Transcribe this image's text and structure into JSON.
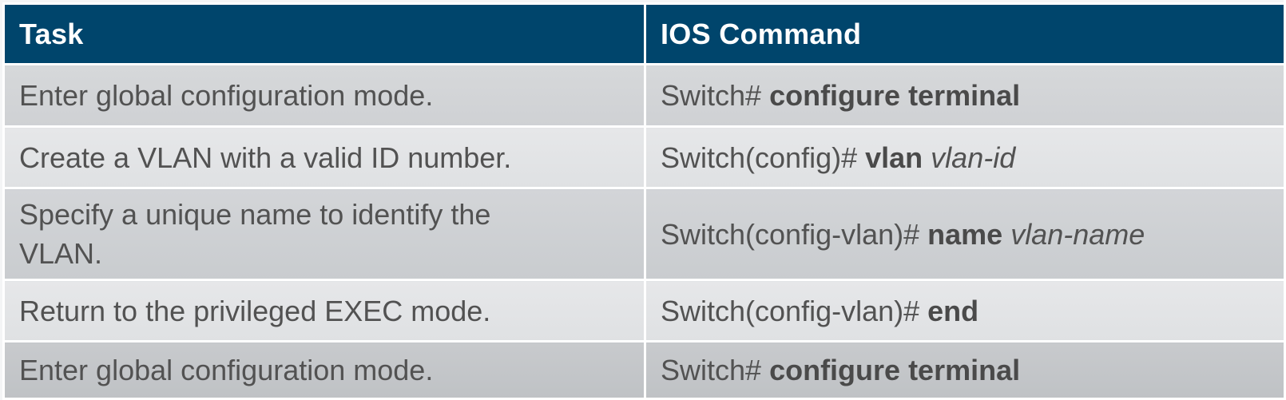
{
  "table": {
    "headers": {
      "task": "Task",
      "command": "IOS Command"
    },
    "rows": [
      {
        "task": "Enter global configuration mode.",
        "prompt": "Switch# ",
        "keyword": "configure terminal",
        "argument": ""
      },
      {
        "task": "Create a VLAN with a valid ID number.",
        "prompt": "Switch(config)# ",
        "keyword": "vlan",
        "argument": "vlan-id"
      },
      {
        "task": "Specify a unique name to identify the VLAN.",
        "prompt": "Switch(config-vlan)# ",
        "keyword": "name",
        "argument": "vlan-name"
      },
      {
        "task": "Return to the privileged EXEC mode.",
        "prompt": "Switch(config-vlan)# ",
        "keyword": "end",
        "argument": ""
      },
      {
        "task": "Enter global configuration mode.",
        "prompt": "Switch# ",
        "keyword": "configure terminal",
        "argument": ""
      }
    ]
  },
  "colors": {
    "header_bg": "#00456c",
    "header_text": "#ffffff",
    "body_text": "#525252"
  }
}
